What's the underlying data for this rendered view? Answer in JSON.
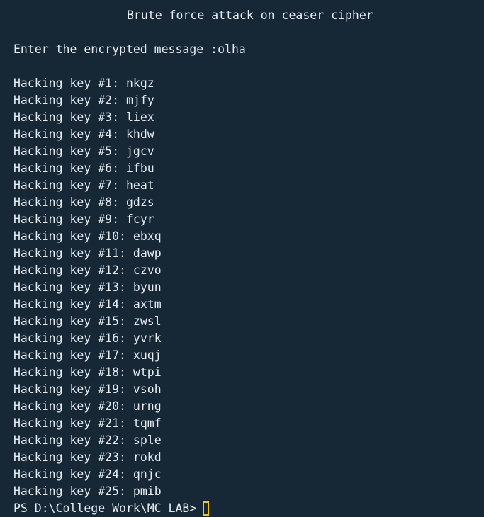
{
  "title": "Brute force attack on ceaser cipher",
  "prompt": {
    "label": "Enter the encrypted message :",
    "value": "olha"
  },
  "results": [
    {
      "label": "Hacking key #1: ",
      "value": "nkgz"
    },
    {
      "label": "Hacking key #2: ",
      "value": "mjfy"
    },
    {
      "label": "Hacking key #3: ",
      "value": "liex"
    },
    {
      "label": "Hacking key #4: ",
      "value": "khdw"
    },
    {
      "label": "Hacking key #5: ",
      "value": "jgcv"
    },
    {
      "label": "Hacking key #6: ",
      "value": "ifbu"
    },
    {
      "label": "Hacking key #7: ",
      "value": "heat"
    },
    {
      "label": "Hacking key #8: ",
      "value": "gdzs"
    },
    {
      "label": "Hacking key #9: ",
      "value": "fcyr"
    },
    {
      "label": "Hacking key #10: ",
      "value": "ebxq"
    },
    {
      "label": "Hacking key #11: ",
      "value": "dawp"
    },
    {
      "label": "Hacking key #12: ",
      "value": "czvo"
    },
    {
      "label": "Hacking key #13: ",
      "value": "byun"
    },
    {
      "label": "Hacking key #14: ",
      "value": "axtm"
    },
    {
      "label": "Hacking key #15: ",
      "value": "zwsl"
    },
    {
      "label": "Hacking key #16: ",
      "value": "yvrk"
    },
    {
      "label": "Hacking key #17: ",
      "value": "xuqj"
    },
    {
      "label": "Hacking key #18: ",
      "value": "wtpi"
    },
    {
      "label": "Hacking key #19: ",
      "value": "vsoh"
    },
    {
      "label": "Hacking key #20: ",
      "value": "urng"
    },
    {
      "label": "Hacking key #21: ",
      "value": "tqmf"
    },
    {
      "label": "Hacking key #22: ",
      "value": "sple"
    },
    {
      "label": "Hacking key #23: ",
      "value": "rokd"
    },
    {
      "label": "Hacking key #24: ",
      "value": "qnjc"
    },
    {
      "label": "Hacking key #25: ",
      "value": "pmib"
    }
  ],
  "shell_prompt": "PS D:\\College Work\\MC LAB>",
  "colors": {
    "background": "#162736",
    "text": "#e8edf2",
    "cursor": "#f5c518"
  }
}
